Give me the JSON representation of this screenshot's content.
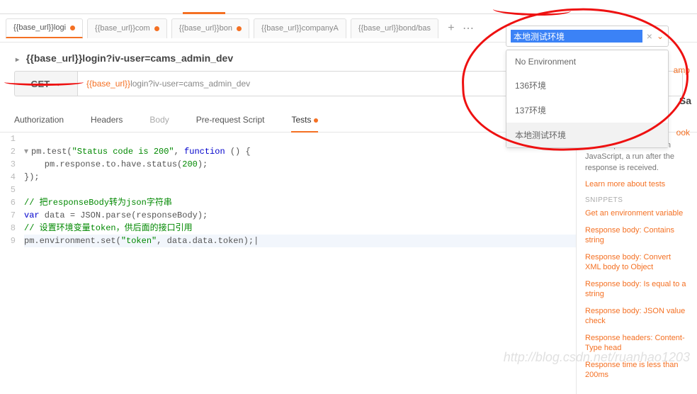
{
  "tabs": [
    {
      "label": "{{base_url}}logi",
      "dirty": true,
      "active": true
    },
    {
      "label": "{{base_url}}com",
      "dirty": true
    },
    {
      "label": "{{base_url}}bon",
      "dirty": true
    },
    {
      "label": "{{base_url}}companyA",
      "dirty": false
    },
    {
      "label": "{{base_url}}bond/bas",
      "dirty": false
    }
  ],
  "env": {
    "search_value": "本地测试环境",
    "options": [
      "No Environment",
      "136环境",
      "137环境",
      "本地测试环境"
    ],
    "selected": "本地测试环境"
  },
  "request": {
    "name": "{{base_url}}login?iv-user=cams_admin_dev",
    "method": "GET",
    "url_prefix": "{{base_url}}",
    "url_suffix": "login?iv-user=cams_admin_dev",
    "save": "Sa",
    "cookies": "ook",
    "examples": "amp"
  },
  "subtabs": {
    "auth": "Authorization",
    "headers": "Headers",
    "body": "Body",
    "prereq": "Pre-request Script",
    "tests": "Tests"
  },
  "editor": {
    "lines": [
      {
        "n": "1",
        "text": ""
      },
      {
        "n": "2",
        "fold": "▾",
        "html": "pm.test(<span class='str'>\"Status code is 200\"</span>, <span class='kw'>function</span> () {"
      },
      {
        "n": "3",
        "html": "    pm.response.to.have.status(<span class='num'>200</span>);"
      },
      {
        "n": "4",
        "html": "});"
      },
      {
        "n": "5",
        "html": ""
      },
      {
        "n": "6",
        "html": "<span class='cmt'>// 把responseBody转为json字符串</span>"
      },
      {
        "n": "7",
        "html": "<span class='kw'>var</span> data = JSON.parse(responseBody);"
      },
      {
        "n": "8",
        "html": "<span class='cmt'>// 设置环境变量token，供后面的接口引用</span>"
      },
      {
        "n": "9",
        "active": true,
        "html": "pm.environment.set(<span class='str'>\"token\"</span>, data.data.token);|"
      }
    ]
  },
  "side": {
    "intro1": "Test scripts are written in JavaScript, a",
    "intro2": "run after the response is received.",
    "learn": "Learn more about tests",
    "snippets_label": "SNIPPETS",
    "snippets": [
      "Get an environment variable",
      "Response body: Contains string",
      "Response body: Convert XML body to Object",
      "Response body: Is equal to a string",
      "Response body: JSON value check",
      "Response headers: Content-Type head",
      "Response time is less than 200ms"
    ]
  },
  "watermark": "http://blog.csdn.net/ruanhao1203"
}
